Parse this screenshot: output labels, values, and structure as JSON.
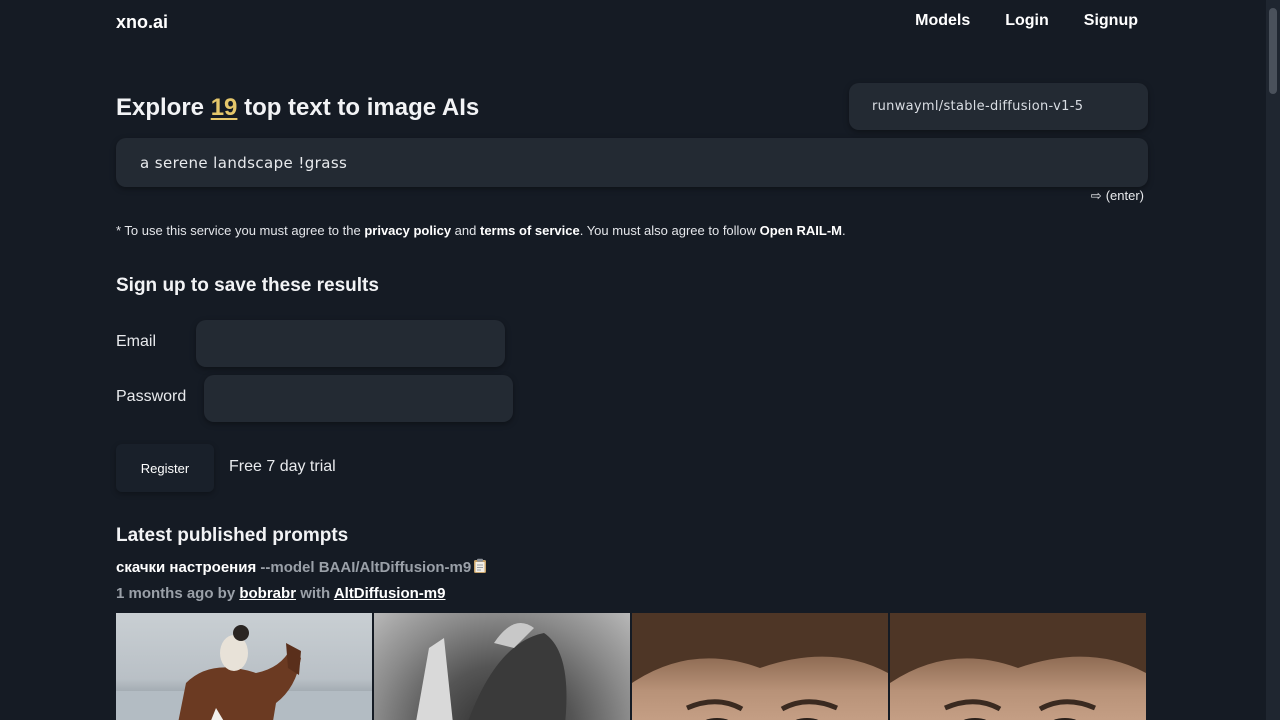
{
  "header": {
    "brand": "xno.ai",
    "nav": [
      "Models",
      "Login",
      "Signup"
    ]
  },
  "hero": {
    "title_prefix": "Explore ",
    "model_count": "19",
    "title_suffix": " top text to image AIs",
    "selected_model": "runwayml/stable-diffusion-v1-5",
    "prompt_value": "a serene landscape !grass",
    "enter_hint": "(enter)",
    "enter_icon": "arrow-right-icon"
  },
  "notice": {
    "p1": "* To use this service you must agree to the ",
    "privacy": "privacy policy",
    "p2": " and ",
    "terms": "terms of service",
    "p3": ". You must also agree to follow ",
    "rail": "Open RAIL-M",
    "p4": "."
  },
  "signup": {
    "title": "Sign up to save these results",
    "email_label": "Email",
    "password_label": "Password",
    "register_label": "Register",
    "trial_text": "Free 7 day trial"
  },
  "latest": {
    "title": "Latest published prompts",
    "prompt_text": "скачки настроения",
    "prompt_flag": " --model BAAI/AltDiffusion-m9",
    "clipboard_icon": "clipboard-icon",
    "time_ago": "1 months ago by ",
    "author": "bobrabr",
    "with": " with ",
    "model_link": "AltDiffusion-m9",
    "images": [
      "horse-rider-thumbnail",
      "horse-closeup-thumbnail",
      "portrait-thumbnail",
      "portrait-thumbnail"
    ]
  }
}
